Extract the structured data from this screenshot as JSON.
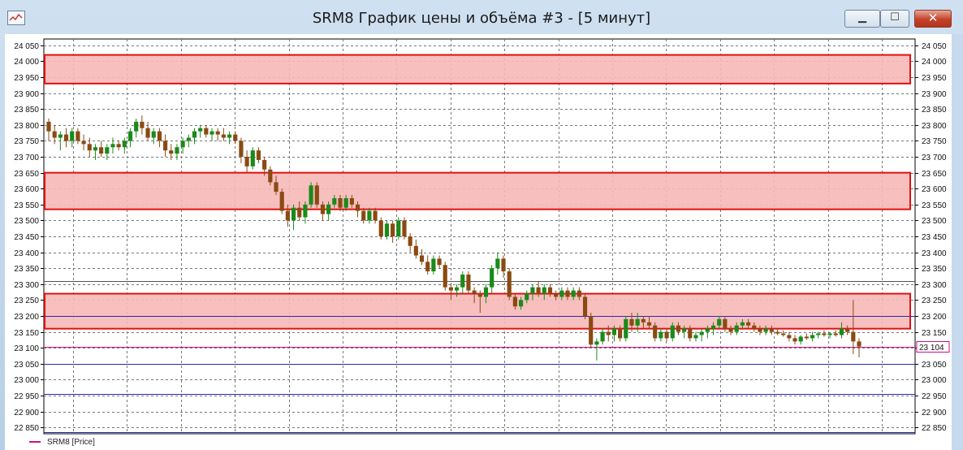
{
  "window": {
    "title": "SRM8 График цены и объёма #3 - [5 минут]",
    "minimize_glyph": "▁",
    "maximize_glyph": "☐",
    "close_glyph": "✕"
  },
  "legend": {
    "label": "SRM8 [Price]",
    "color": "#c8108a"
  },
  "chart_data": {
    "type": "candlestick",
    "title": "SRM8 График цены и объёма #3 - [5 минут]",
    "ylim": [
      22830,
      24070
    ],
    "yticks": [
      22850,
      22900,
      22950,
      23000,
      23050,
      23100,
      23150,
      23200,
      23250,
      23300,
      23350,
      23400,
      23450,
      23500,
      23550,
      23600,
      23650,
      23700,
      23750,
      23800,
      23850,
      23900,
      23950,
      24000,
      24050
    ],
    "ytick_labels": [
      "22 850",
      "22 900",
      "22 950",
      "23 000",
      "23 050",
      "23 100",
      "23 150",
      "23 200",
      "23 250",
      "23 300",
      "23 350",
      "23 400",
      "23 450",
      "23 500",
      "23 550",
      "23 600",
      "23 650",
      "23 700",
      "23 750",
      "23 800",
      "23 850",
      "23 900",
      "23 950",
      "24 000",
      "24 050"
    ],
    "last_price": 23104,
    "last_price_label": "23 104",
    "grid": true,
    "up_color": "#1a8a1a",
    "down_color": "#8a4a12",
    "zones": [
      {
        "low": 23930,
        "high": 24020
      },
      {
        "low": 23535,
        "high": 23650
      },
      {
        "low": 23160,
        "high": 23270
      }
    ],
    "zone_fill": "#f7b8b8",
    "zone_stroke": "#e01010",
    "hlines": [
      {
        "price": 23200,
        "color": "#2a2aa8"
      },
      {
        "price": 23050,
        "color": "#2a2aa8"
      },
      {
        "price": 22955,
        "color": "#2a2aa8"
      },
      {
        "price": 22835,
        "color": "#2a2aa8"
      },
      {
        "price": 23310,
        "color": "#555555"
      }
    ],
    "candles": [
      [
        23810,
        23820,
        23750,
        23780
      ],
      [
        23780,
        23800,
        23740,
        23760
      ],
      [
        23760,
        23780,
        23720,
        23770
      ],
      [
        23770,
        23790,
        23730,
        23750
      ],
      [
        23750,
        23790,
        23730,
        23780
      ],
      [
        23780,
        23790,
        23740,
        23750
      ],
      [
        23750,
        23770,
        23720,
        23740
      ],
      [
        23740,
        23760,
        23700,
        23720
      ],
      [
        23720,
        23740,
        23690,
        23730
      ],
      [
        23730,
        23750,
        23700,
        23710
      ],
      [
        23710,
        23740,
        23690,
        23730
      ],
      [
        23730,
        23760,
        23710,
        23740
      ],
      [
        23740,
        23750,
        23720,
        23730
      ],
      [
        23730,
        23760,
        23710,
        23750
      ],
      [
        23750,
        23790,
        23730,
        23780
      ],
      [
        23780,
        23820,
        23760,
        23810
      ],
      [
        23810,
        23830,
        23770,
        23790
      ],
      [
        23790,
        23810,
        23750,
        23760
      ],
      [
        23760,
        23790,
        23740,
        23780
      ],
      [
        23780,
        23790,
        23730,
        23750
      ],
      [
        23750,
        23770,
        23700,
        23720
      ],
      [
        23720,
        23740,
        23690,
        23710
      ],
      [
        23710,
        23740,
        23690,
        23730
      ],
      [
        23730,
        23760,
        23710,
        23750
      ],
      [
        23750,
        23770,
        23730,
        23760
      ],
      [
        23760,
        23790,
        23740,
        23780
      ],
      [
        23780,
        23800,
        23760,
        23790
      ],
      [
        23790,
        23800,
        23760,
        23770
      ],
      [
        23770,
        23790,
        23750,
        23780
      ],
      [
        23780,
        23790,
        23750,
        23770
      ],
      [
        23770,
        23790,
        23750,
        23760
      ],
      [
        23760,
        23780,
        23740,
        23770
      ],
      [
        23770,
        23780,
        23740,
        23750
      ],
      [
        23750,
        23760,
        23680,
        23700
      ],
      [
        23700,
        23720,
        23650,
        23670
      ],
      [
        23670,
        23730,
        23660,
        23720
      ],
      [
        23720,
        23730,
        23680,
        23690
      ],
      [
        23690,
        23700,
        23640,
        23660
      ],
      [
        23660,
        23670,
        23610,
        23620
      ],
      [
        23620,
        23640,
        23580,
        23590
      ],
      [
        23590,
        23600,
        23520,
        23530
      ],
      [
        23530,
        23550,
        23480,
        23500
      ],
      [
        23500,
        23550,
        23470,
        23540
      ],
      [
        23540,
        23560,
        23500,
        23510
      ],
      [
        23510,
        23560,
        23490,
        23550
      ],
      [
        23550,
        23620,
        23540,
        23610
      ],
      [
        23610,
        23620,
        23540,
        23550
      ],
      [
        23550,
        23560,
        23500,
        23520
      ],
      [
        23520,
        23560,
        23500,
        23550
      ],
      [
        23550,
        23580,
        23540,
        23570
      ],
      [
        23570,
        23580,
        23530,
        23540
      ],
      [
        23540,
        23580,
        23530,
        23570
      ],
      [
        23570,
        23580,
        23540,
        23550
      ],
      [
        23550,
        23560,
        23510,
        23530
      ],
      [
        23530,
        23540,
        23490,
        23500
      ],
      [
        23500,
        23540,
        23490,
        23530
      ],
      [
        23530,
        23540,
        23490,
        23500
      ],
      [
        23500,
        23510,
        23440,
        23450
      ],
      [
        23450,
        23500,
        23440,
        23490
      ],
      [
        23490,
        23500,
        23430,
        23450
      ],
      [
        23450,
        23510,
        23440,
        23500
      ],
      [
        23500,
        23510,
        23440,
        23450
      ],
      [
        23450,
        23460,
        23400,
        23420
      ],
      [
        23420,
        23440,
        23380,
        23390
      ],
      [
        23390,
        23410,
        23360,
        23370
      ],
      [
        23370,
        23390,
        23330,
        23340
      ],
      [
        23340,
        23390,
        23330,
        23380
      ],
      [
        23380,
        23390,
        23350,
        23360
      ],
      [
        23360,
        23370,
        23280,
        23290
      ],
      [
        23290,
        23300,
        23250,
        23280
      ],
      [
        23280,
        23300,
        23260,
        23290
      ],
      [
        23290,
        23340,
        23270,
        23330
      ],
      [
        23330,
        23340,
        23270,
        23280
      ],
      [
        23280,
        23290,
        23240,
        23270
      ],
      [
        23270,
        23280,
        23210,
        23260
      ],
      [
        23260,
        23300,
        23240,
        23290
      ],
      [
        23290,
        23360,
        23270,
        23350
      ],
      [
        23350,
        23400,
        23330,
        23380
      ],
      [
        23380,
        23390,
        23320,
        23340
      ],
      [
        23340,
        23350,
        23250,
        23260
      ],
      [
        23260,
        23270,
        23220,
        23230
      ],
      [
        23230,
        23260,
        23220,
        23250
      ],
      [
        23250,
        23280,
        23240,
        23270
      ],
      [
        23270,
        23300,
        23250,
        23290
      ],
      [
        23290,
        23310,
        23260,
        23270
      ],
      [
        23270,
        23300,
        23250,
        23290
      ],
      [
        23290,
        23300,
        23260,
        23270
      ],
      [
        23270,
        23280,
        23250,
        23260
      ],
      [
        23260,
        23290,
        23250,
        23280
      ],
      [
        23280,
        23290,
        23250,
        23260
      ],
      [
        23260,
        23290,
        23250,
        23280
      ],
      [
        23280,
        23290,
        23250,
        23260
      ],
      [
        23260,
        23270,
        23190,
        23200
      ],
      [
        23200,
        23210,
        23100,
        23110
      ],
      [
        23110,
        23130,
        23060,
        23120
      ],
      [
        23120,
        23160,
        23110,
        23150
      ],
      [
        23150,
        23170,
        23120,
        23140
      ],
      [
        23140,
        23170,
        23120,
        23160
      ],
      [
        23160,
        23170,
        23120,
        23130
      ],
      [
        23130,
        23200,
        23120,
        23190
      ],
      [
        23190,
        23210,
        23150,
        23170
      ],
      [
        23170,
        23210,
        23150,
        23190
      ],
      [
        23190,
        23200,
        23160,
        23180
      ],
      [
        23180,
        23200,
        23160,
        23170
      ],
      [
        23170,
        23180,
        23120,
        23130
      ],
      [
        23130,
        23160,
        23120,
        23150
      ],
      [
        23150,
        23160,
        23120,
        23130
      ],
      [
        23130,
        23180,
        23120,
        23170
      ],
      [
        23170,
        23180,
        23140,
        23150
      ],
      [
        23150,
        23170,
        23130,
        23160
      ],
      [
        23160,
        23170,
        23120,
        23130
      ],
      [
        23130,
        23150,
        23120,
        23140
      ],
      [
        23140,
        23160,
        23120,
        23150
      ],
      [
        23150,
        23170,
        23130,
        23160
      ],
      [
        23160,
        23180,
        23140,
        23170
      ],
      [
        23170,
        23200,
        23160,
        23190
      ],
      [
        23190,
        23200,
        23150,
        23160
      ],
      [
        23160,
        23170,
        23140,
        23150
      ],
      [
        23150,
        23180,
        23140,
        23170
      ],
      [
        23170,
        23190,
        23160,
        23180
      ],
      [
        23180,
        23190,
        23160,
        23170
      ],
      [
        23170,
        23180,
        23150,
        23160
      ],
      [
        23160,
        23170,
        23140,
        23150
      ],
      [
        23150,
        23170,
        23140,
        23160
      ],
      [
        23160,
        23170,
        23140,
        23150
      ],
      [
        23150,
        23160,
        23140,
        23145
      ],
      [
        23145,
        23155,
        23135,
        23140
      ],
      [
        23140,
        23150,
        23120,
        23130
      ],
      [
        23130,
        23140,
        23110,
        23120
      ],
      [
        23120,
        23140,
        23110,
        23135
      ],
      [
        23135,
        23145,
        23125,
        23130
      ],
      [
        23130,
        23150,
        23120,
        23140
      ],
      [
        23140,
        23150,
        23130,
        23145
      ],
      [
        23145,
        23155,
        23135,
        23140
      ],
      [
        23140,
        23150,
        23130,
        23145
      ],
      [
        23145,
        23155,
        23135,
        23140
      ],
      [
        23140,
        23180,
        23130,
        23160
      ],
      [
        23160,
        23170,
        23140,
        23150
      ],
      [
        23150,
        23250,
        23080,
        23120
      ],
      [
        23120,
        23130,
        23070,
        23104
      ]
    ]
  }
}
